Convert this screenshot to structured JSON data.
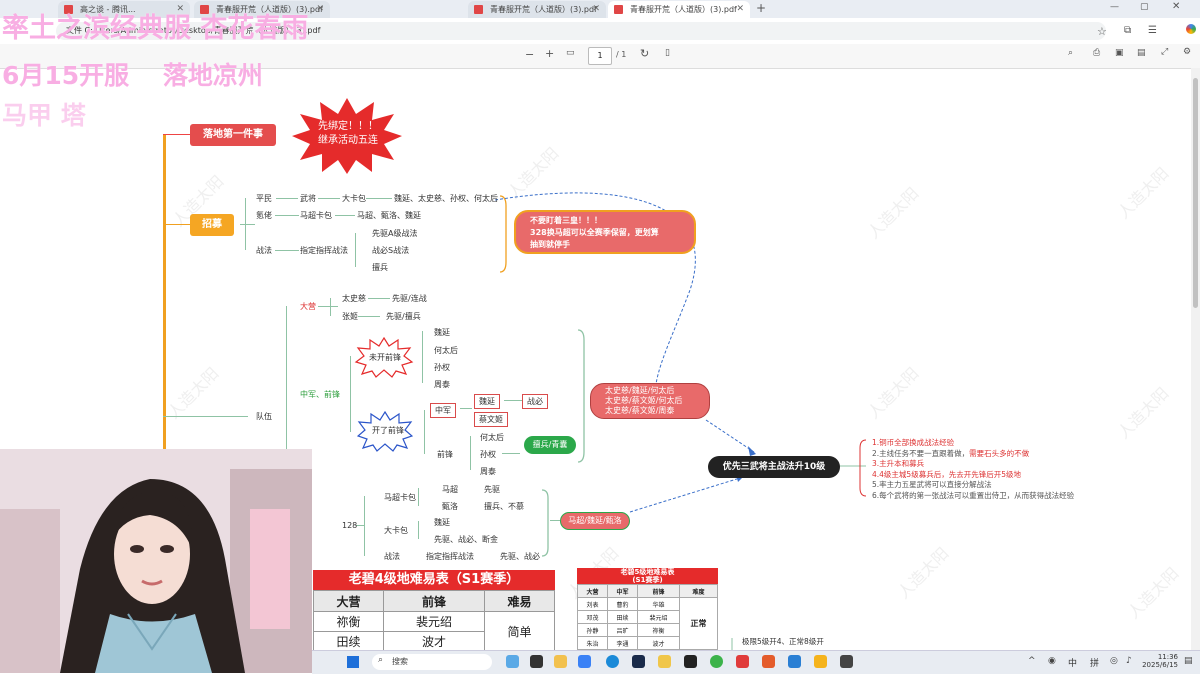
{
  "browser": {
    "tabs": [
      {
        "label": "高之谈 - 腾讯..."
      },
      {
        "label": "青春服开荒（人道版）(3).pdf"
      },
      {
        "label": "青春服开荒（人道版）(3).pdf"
      },
      {
        "label": "青春服开荒（人道版）(3).pdf"
      }
    ],
    "url": "文件  C:/Users/Administrator/Desktop/青春服开荒（人道版）(3).pdf",
    "page_current": "1",
    "page_total": "/ 1"
  },
  "overlay": {
    "line1": "率土之滨经典服 杏花春雨",
    "line2": "6月15开服　 落地凉州",
    "line3": "马甲 塔"
  },
  "mindmap": {
    "root1": "落地第一件事",
    "burst1": "先绑定！！！\n继承活动五连",
    "root2": "招募",
    "recruit": {
      "pingmin": "平民",
      "wujiang": "武将",
      "dakabao": "大卡包",
      "wei_list": "魏延、太史慈、孙权、何太后",
      "fulao": "氪佬",
      "mcbag": "马超卡包",
      "mc_list": "马超、甄洛、魏延",
      "zhanfa": "战法",
      "zhiding": "指定指挥战法",
      "xianzhen": "先驱A级战法",
      "zhanbi": "战必S战法",
      "qiangbing": "擅兵"
    },
    "warn_pill": "不要盯着三皇！！！\n328换马超可以全赛季保留，更划算\n抽到就停手",
    "team": "队伍",
    "daying": "大营",
    "dy1_name": "太史慈",
    "dy1_skill": "先驱/连战",
    "dy2_name": "张姬",
    "dy2_skill": "先驱/擅兵",
    "zhongjun": "中军、前锋",
    "burst_no": "未开前锋",
    "no_list": [
      "魏延",
      "何太后",
      "孙权",
      "周泰"
    ],
    "burst_yes": "开了前锋",
    "zj_box": "中军",
    "zj_wei": "魏延",
    "zj_zb": "战必",
    "zj_cai": "蔡文姬",
    "qianfeng": "前锋",
    "qf_list": [
      "何太后",
      "孙权",
      "周泰"
    ],
    "green_pill": "擅兵/青囊",
    "right_pill": "太史慈/魏延/何太后\n太史慈/蔡文姬/何太后\n太史慈/蔡文姬/周泰",
    "main_pill": "优先三武将主战法升10级",
    "tips": [
      {
        "text": "1.铜币全部换成战法经验",
        "color": "#d33"
      },
      {
        "text": "2.主线任务不要一直跟着做，",
        "extra": "需要石头多的不做",
        "color": "#555"
      },
      {
        "text": "3.主升本和募兵",
        "color": "#d33"
      },
      {
        "text": "4.4级主城5级募兵后，先去开先锋后开5级地",
        "color": "#d33"
      },
      {
        "text": "5.率主力五星武将可以直接分解战法",
        "color": "#555"
      },
      {
        "text": "6.每个武将的第一张战法可以重置出侍卫，从而获得战法经验",
        "color": "#555"
      }
    ],
    "n128": "128",
    "mc_bag": "马超卡包",
    "mc_a": "马超",
    "mc_a_s": "先驱",
    "mc_b": "甄洛",
    "mc_b_s": "擅兵、不慕",
    "big_bag": "大卡包",
    "bb_a": "魏延",
    "bb_b": "先驱、战必、断金",
    "zf": "战法",
    "zf_a": "指定指挥战法",
    "zf_b": "先驱、战必",
    "bot_pill": "马超/魏延/甄洛",
    "bottom_note": "极限5级开4、正常8级开"
  },
  "table1": {
    "title": "老碧4级地难易表（S1赛季）",
    "headers": [
      "大营",
      "前锋",
      "难易"
    ],
    "rows": [
      [
        "祢衡",
        "裴元绍"
      ],
      [
        "田续",
        "波才"
      ]
    ],
    "difficulty": "简单"
  },
  "table2": {
    "title": "老碧5级地难易表",
    "subtitle": "(S1赛季)",
    "headers": [
      "大营",
      "中军",
      "前锋",
      "难度"
    ],
    "rows": [
      [
        "刘表",
        "曹豹",
        "华雄"
      ],
      [
        "邓茂",
        "田续",
        "裴元绍"
      ],
      [
        "孙静",
        "吕旷",
        "祢衡"
      ],
      [
        "朱治",
        "李通",
        "波才"
      ]
    ],
    "difficulty": "正常"
  },
  "watermark": "人造太阳",
  "taskbar": {
    "search": "搜索",
    "ime1": "中",
    "ime2": "拼",
    "time": "11:36",
    "date": "2025/6/15"
  }
}
